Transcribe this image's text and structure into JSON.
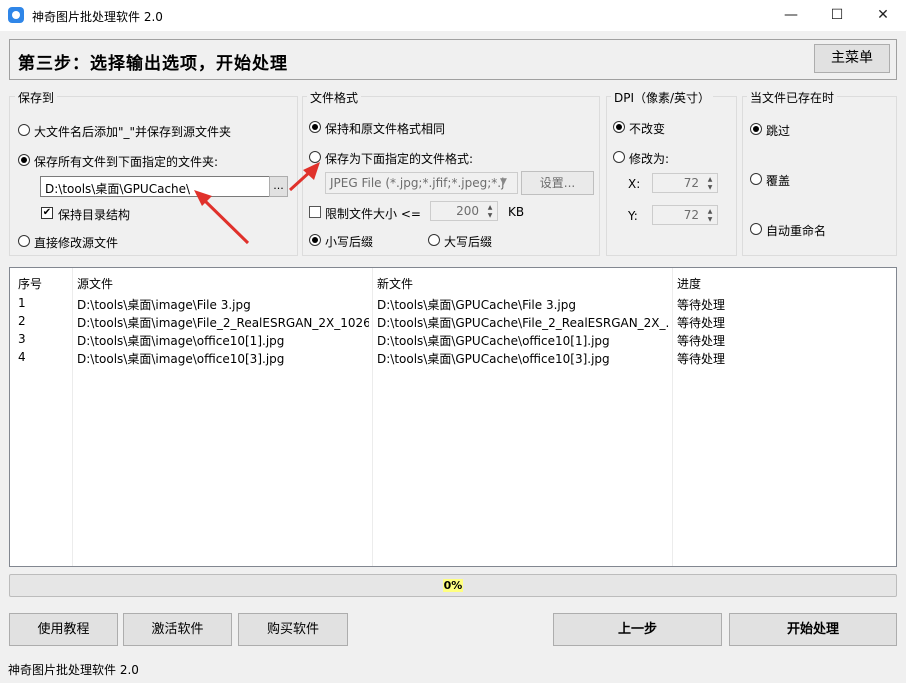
{
  "window": {
    "title": "神奇图片批处理软件 2.0",
    "minimize": "—",
    "maximize": "☐",
    "close": "✕"
  },
  "header": {
    "step_title": "第三步：选择输出选项，开始处理",
    "main_menu_button": "主菜单"
  },
  "save_to": {
    "label": "保存到",
    "option_suffix": "大文件名后添加\"_\"并保存到源文件夹",
    "option_folder": "保存所有文件到下面指定的文件夹:",
    "folder_path": "D:\\tools\\桌面\\GPUCache\\",
    "browse_button": "...",
    "keep_structure": "保持目录结构",
    "option_overwrite": "直接修改源文件",
    "selected": "option_folder"
  },
  "file_format": {
    "label": "文件格式",
    "option_same": "保持和原文件格式相同",
    "option_specified": "保存为下面指定的文件格式:",
    "format_select": "JPEG File (*.jpg;*.jfif;*.jpeg;*.j",
    "settings_button": "设置...",
    "limit_size": "限制文件大小 <=",
    "limit_value": "200",
    "limit_unit": "KB",
    "lowercase_ext": "小写后缀",
    "uppercase_ext": "大写后缀"
  },
  "dpi": {
    "label": "DPI（像素/英寸）",
    "option_keep": "不改变",
    "option_change": "修改为:",
    "x_label": "X:",
    "x_value": "72",
    "y_label": "Y:",
    "y_value": "72"
  },
  "exists": {
    "label": "当文件已存在时",
    "option_skip": "跳过",
    "option_overwrite": "覆盖",
    "option_rename": "自动重命名"
  },
  "table": {
    "headers": [
      "序号",
      "源文件",
      "新文件",
      "进度"
    ],
    "rows": [
      [
        "1",
        "D:\\tools\\桌面\\image\\File 3.jpg",
        "D:\\tools\\桌面\\GPUCache\\File 3.jpg",
        "等待处理"
      ],
      [
        "2",
        "D:\\tools\\桌面\\image\\File_2_RealESRGAN_2X_1026...",
        "D:\\tools\\桌面\\GPUCache\\File_2_RealESRGAN_2X_...",
        "等待处理"
      ],
      [
        "3",
        "D:\\tools\\桌面\\image\\office10[1].jpg",
        "D:\\tools\\桌面\\GPUCache\\office10[1].jpg",
        "等待处理"
      ],
      [
        "4",
        "D:\\tools\\桌面\\image\\office10[3].jpg",
        "D:\\tools\\桌面\\GPUCache\\office10[3].jpg",
        "等待处理"
      ]
    ]
  },
  "progress": {
    "value": 0,
    "text": "0%"
  },
  "buttons": {
    "tutorial": "使用教程",
    "activate": "激活软件",
    "buy": "购买软件",
    "previous": "上一步",
    "start": "开始处理"
  },
  "status": {
    "text": "神奇图片批处理软件 2.0"
  },
  "colors": {
    "accent": "#2f86e8",
    "annotation_arrow": "#e0312b",
    "progress_label_bg": "#ffff80"
  }
}
